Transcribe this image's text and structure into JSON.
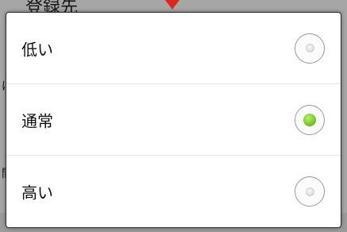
{
  "background": {
    "partial_title": "登録先",
    "edge_chars": [
      "ほ",
      "間"
    ]
  },
  "dialog": {
    "options": [
      {
        "label": "低い",
        "selected": false
      },
      {
        "label": "通常",
        "selected": true
      },
      {
        "label": "高い",
        "selected": false
      }
    ],
    "accent_color": "#7ccf2a",
    "arrow_color": "#e0261c"
  }
}
